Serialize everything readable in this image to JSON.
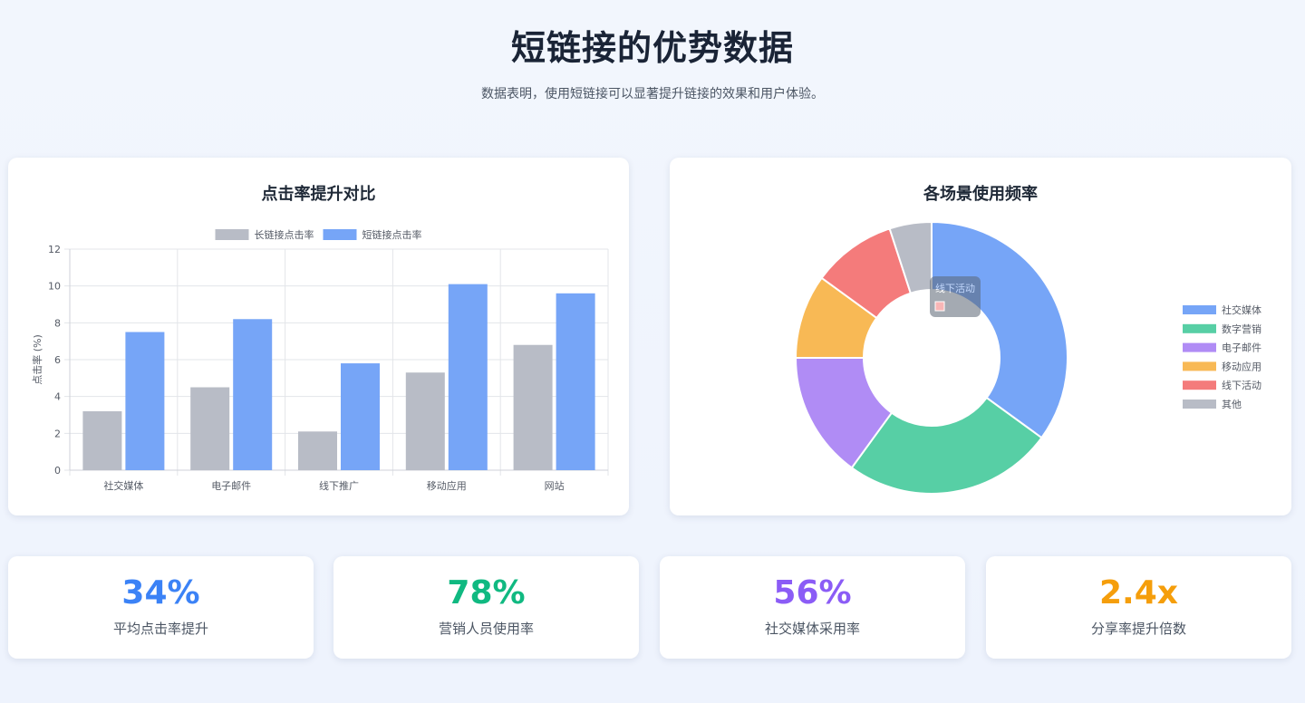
{
  "header": {
    "title": "短链接的优势数据",
    "subtitle": "数据表明，使用短链接可以显著提升链接的效果和用户体验。"
  },
  "chart_data": [
    {
      "type": "bar",
      "title": "点击率提升对比",
      "categories": [
        "社交媒体",
        "电子邮件",
        "线下推广",
        "移动应用",
        "网站"
      ],
      "series": [
        {
          "name": "长链接点击率",
          "values": [
            3.2,
            4.5,
            2.1,
            5.3,
            6.8
          ],
          "color": "#b8bcc6"
        },
        {
          "name": "短链接点击率",
          "values": [
            7.5,
            8.2,
            5.8,
            10.1,
            9.6
          ],
          "color": "#76a5f7"
        }
      ],
      "xlabel": "",
      "ylabel": "点击率 (%)",
      "ylim": [
        0,
        12
      ],
      "yticks": [
        0,
        2,
        4,
        6,
        8,
        10,
        12
      ],
      "grid": true,
      "legend": "top"
    },
    {
      "type": "pie",
      "title": "各场景使用频率",
      "labels": [
        "社交媒体",
        "数字营销",
        "电子邮件",
        "移动应用",
        "线下活动",
        "其他"
      ],
      "values": [
        35,
        25,
        15,
        10,
        10,
        5
      ],
      "colors": [
        "#76a5f7",
        "#57cfa5",
        "#b08cf5",
        "#f8b955",
        "#f47b7b",
        "#b8bcc6"
      ],
      "donut": true,
      "legend": "right",
      "tooltip_label": "线下活动"
    }
  ],
  "stats": [
    {
      "value": "34%",
      "label": "平均点击率提升",
      "color": "#3b82f6"
    },
    {
      "value": "78%",
      "label": "营销人员使用率",
      "color": "#10b981"
    },
    {
      "value": "56%",
      "label": "社交媒体采用率",
      "color": "#8b5cf6"
    },
    {
      "value": "2.4x",
      "label": "分享率提升倍数",
      "color": "#f59e0b"
    }
  ]
}
